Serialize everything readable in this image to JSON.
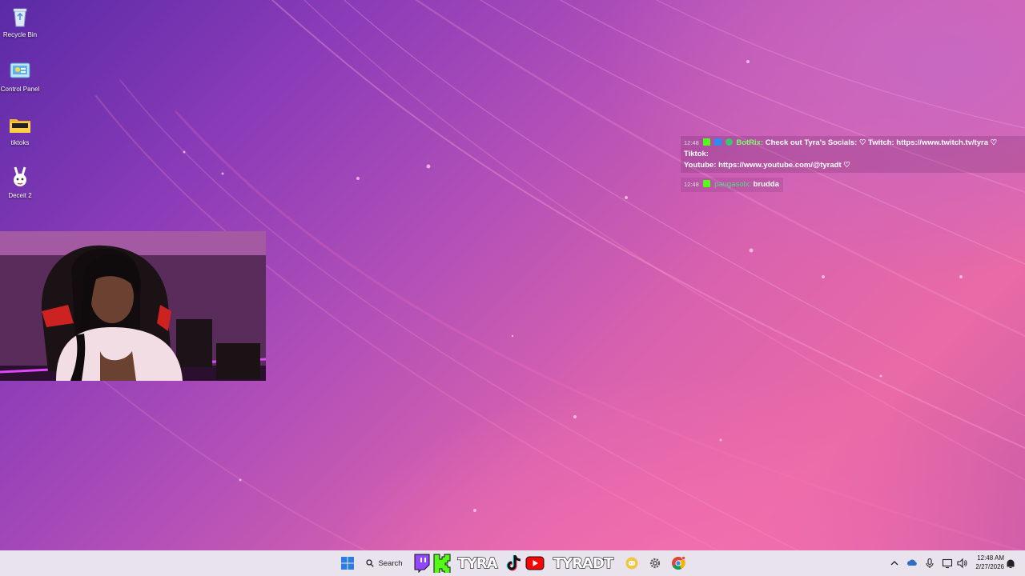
{
  "desktop": {
    "icons": [
      {
        "label": "Recycle Bin",
        "icon": "recycle-bin-icon"
      },
      {
        "label": "Control Panel",
        "icon": "control-panel-icon"
      },
      {
        "label": "tiktoks",
        "icon": "folder-icon"
      },
      {
        "label": "Deceit 2",
        "icon": "deceit-2-icon"
      }
    ]
  },
  "chat": {
    "messages": [
      {
        "time": "12:48",
        "user": "BotRix:",
        "text": "Check out Tyra's Socials: ♡ Twitch: https://www.twitch.tv/tyra ♡ Tiktok:",
        "text2": "Youtube: https://www.youtube.com/@tyradt ♡"
      },
      {
        "time": "12:48",
        "user": "paugasolx:",
        "text": "brudda"
      }
    ]
  },
  "taskbar": {
    "search_label": "Search",
    "stream_name_kick": "TYRA",
    "stream_name_youtube": "TYRADT",
    "clock_time": "12:48 AM",
    "clock_date": "2/27/2026",
    "icons": [
      "windows-start-icon",
      "search-icon",
      "twitch-icon",
      "kick-icon",
      "tiktok-icon",
      "youtube-icon",
      "discord-icon",
      "settings-icon",
      "chrome-icon",
      "chevron-up-icon",
      "onedrive-icon",
      "microphone-icon",
      "network-icon",
      "speaker-icon",
      "notification-icon"
    ]
  },
  "colors": {
    "kick_green": "#53fc18",
    "twitch_purple": "#9146ff",
    "youtube_red": "#ff0000",
    "chat_user_green": "#7cff6a"
  }
}
